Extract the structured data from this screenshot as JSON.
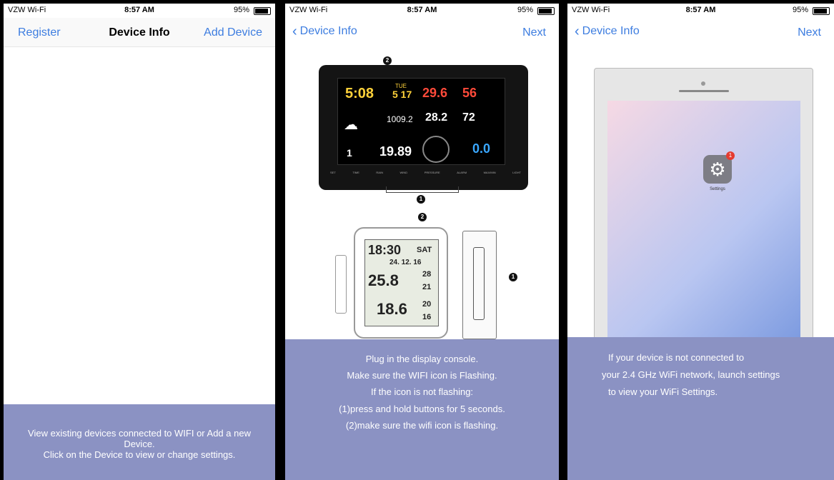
{
  "status": {
    "carrier": "VZW Wi-Fi",
    "time": "8:57 AM",
    "battery": "95%"
  },
  "screen1": {
    "nav": {
      "left": "Register",
      "title": "Device Info",
      "right": "Add Device"
    },
    "panel_text": "View existing devices connected to WIFI or Add a new Device.\nClick on the Device to view or change settings."
  },
  "screen2": {
    "nav": {
      "back": "Device Info",
      "right": "Next"
    },
    "console": {
      "time": "5:08",
      "day": "TUE",
      "date": "5 17",
      "indoor_temp": "29.6",
      "indoor_hum": "56",
      "pressure": "1009.2",
      "outdoor_temp": "28.2",
      "outdoor_hum": "72",
      "rain": "19.89",
      "wind": "0.0",
      "uv": "1",
      "labels": [
        "SET",
        "TIME",
        "RAIN",
        "WIND",
        "PRESSURE",
        "ALARM",
        "MAX/MIN",
        "LIGHT"
      ]
    },
    "lcd": {
      "time": "18:30",
      "day": "SAT",
      "date": "24. 12. 16",
      "indoor_temp": "25.8",
      "indoor_hum": "28",
      "outdoor_temp": "18.6",
      "side1": "21",
      "side2": "20",
      "side3": "16"
    },
    "markers": [
      "1",
      "2"
    ],
    "lines": [
      "Plug in the display console.",
      "Make sure the WIFI icon is Flashing.",
      "If the icon is not flashing:",
      "(1)press and hold buttons for 5 seconds.",
      "(2)make sure the wifi icon is flashing."
    ]
  },
  "screen3": {
    "nav": {
      "back": "Device Info",
      "right": "Next"
    },
    "settings_label": "Settings",
    "notification_count": "1",
    "lines": [
      "If your device is not connected to",
      "your 2.4 GHz WiFi network, launch settings",
      "to  view your WiFi Settings."
    ]
  }
}
